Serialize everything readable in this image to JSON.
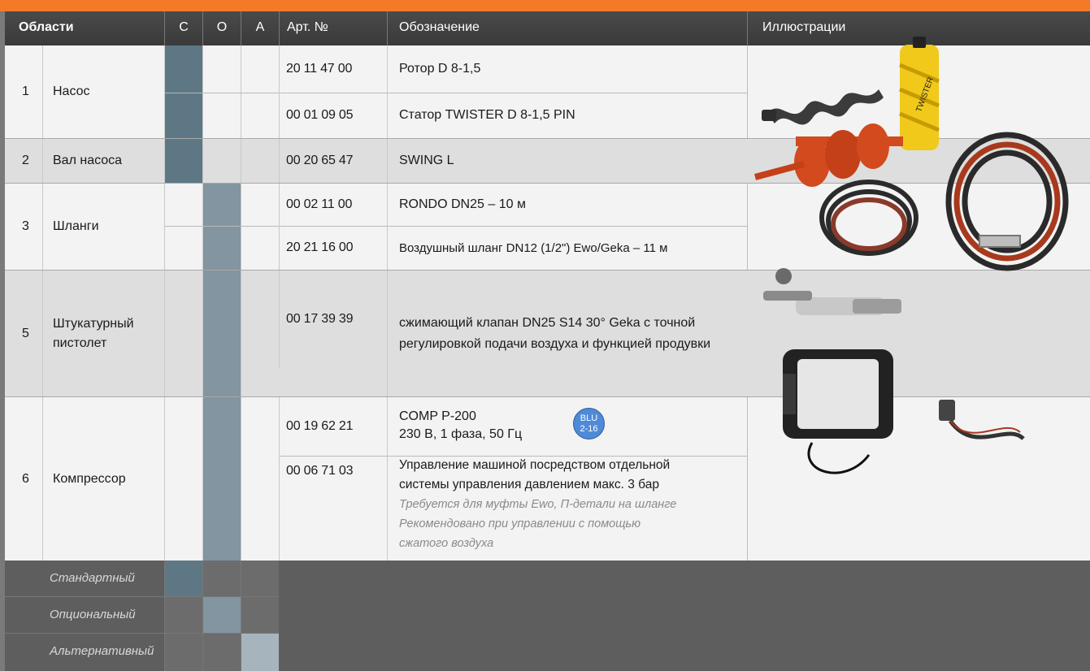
{
  "header": {
    "areas": "Области",
    "col_c": "C",
    "col_o": "O",
    "col_a": "A",
    "art": "Арт. №",
    "designation": "Обозначение",
    "illustrations": "Иллюстрации"
  },
  "rows": [
    {
      "num": "1",
      "area": "Насос",
      "items": [
        {
          "art": "20 11 47 00",
          "desc": "Ротор D 8-1,5",
          "c": "standard"
        },
        {
          "art": "00 01 09 05",
          "desc": "Статор TWISTER D 8-1,5 PIN",
          "c": "standard"
        }
      ]
    },
    {
      "num": "2",
      "area": "Вал насоса",
      "items": [
        {
          "art": "00 20 65 47",
          "desc": "SWING L",
          "c": "standard"
        }
      ]
    },
    {
      "num": "3",
      "area": "Шланги",
      "items": [
        {
          "art": "00 02 11 00",
          "desc": "RONDO DN25 – 10 м",
          "o": "optional"
        },
        {
          "art": "20 21 16 00",
          "desc": "Воздушный шланг DN12 (1/2\") Ewo/Geka – 11 м",
          "o": "optional"
        }
      ]
    },
    {
      "num": "5",
      "area": "Штукатурный пистолет",
      "items": [
        {
          "art": "00 17 39 39",
          "desc": "сжимающий клапан DN25 S14 30° Geka с точной регулировкой подачи воздуха и функцией продувки",
          "o": "optional"
        }
      ]
    },
    {
      "num": "6",
      "area": "Компрессор",
      "items": [
        {
          "art": "00 19 62 21",
          "desc_line1": "COMP P-200",
          "desc_line2": "230 В, 1 фаза, 50 Гц",
          "badge_line1": "BLU",
          "badge_line2": "2-16",
          "o": "optional"
        },
        {
          "art": "00 06 71 03",
          "desc_line1": "Управление машиной посредством отдельной",
          "desc_line2": "системы управления давлением макс. 3 бар",
          "note_line1": "Требуется для муфты Ewo, П-детали на шланге",
          "note_line2": "Рекомендовано при управлении с помощью",
          "note_line3": "сжатого воздуха",
          "o": "optional"
        }
      ]
    }
  ],
  "legend": {
    "standard": "Стандартный",
    "optional": "Опциональный",
    "alternative": "Альтернативный"
  },
  "colors": {
    "accent_orange": "#f47a2a",
    "standard": "#5d7884",
    "optional": "#8295a0",
    "alternative": "#a6b5bd"
  }
}
